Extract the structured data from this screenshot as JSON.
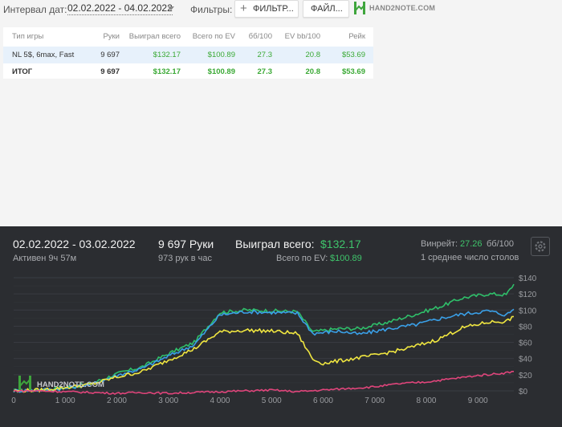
{
  "toolbar": {
    "date_label": "Интервал дат:",
    "date_range": "02.02.2022 - 04.02.2022",
    "filters_label": "Фильтры:",
    "filter_button": "ФИЛЬТР...",
    "files_button": "ФАЙЛ...",
    "logo_text": "HAND2NOTE.COM"
  },
  "table": {
    "headers": [
      "Тип игры",
      "Руки",
      "Выиграл всего",
      "Всего по EV",
      "бб/100",
      "EV bb/100",
      "Рейк"
    ],
    "rows": [
      [
        "NL 5$, 6max, Fast",
        "9 697",
        "$132.17",
        "$100.89",
        "27.3",
        "20.8",
        "$53.69"
      ],
      [
        "ИТОГ",
        "9 697",
        "$132.17",
        "$100.89",
        "27.3",
        "20.8",
        "$53.69"
      ]
    ]
  },
  "panel": {
    "date_range": "02.02.2022 - 03.02.2022",
    "active": "Активен 9ч 57м",
    "hands": "9 697 Руки",
    "hands_per_hour": "973 рук в час",
    "won_label": "Выиграл всего:",
    "won_value": "$132.17",
    "ev_label": "Всего по EV:",
    "ev_value": "$100.89",
    "winrate_label": "Винрейт:",
    "winrate_value": "27.26",
    "winrate_unit": "бб/100",
    "tables": "1 среднее число столов",
    "logo_text": "HAND2NOTE.COM",
    "gear_icon": "gear-icon"
  },
  "colors": {
    "won": "#2fbf6a",
    "ev": "#3aa0e8",
    "showdown": "#f0e640",
    "non_showdown": "#e0457b",
    "positive": "#3aa935"
  },
  "chart_data": {
    "type": "line",
    "x_ticks": [
      "0",
      "1 000",
      "2 000",
      "3 000",
      "4 000",
      "5 000",
      "6 000",
      "7 000",
      "8 000",
      "9 000"
    ],
    "y_ticks": [
      "$140",
      "$120",
      "$100",
      "$80",
      "$60",
      "$40",
      "$20",
      "$0"
    ],
    "xlim": [
      0,
      9697
    ],
    "ylim": [
      -5,
      145
    ],
    "series": [
      {
        "color": "#2fbf6a",
        "points": [
          [
            0,
            0
          ],
          [
            500,
            1
          ],
          [
            1000,
            4
          ],
          [
            1500,
            9
          ],
          [
            2000,
            21
          ],
          [
            2500,
            30
          ],
          [
            3000,
            46
          ],
          [
            3500,
            60
          ],
          [
            4000,
            97
          ],
          [
            4500,
            100
          ],
          [
            5000,
            99
          ],
          [
            5500,
            98
          ],
          [
            5800,
            73
          ],
          [
            6300,
            77
          ],
          [
            6700,
            77
          ],
          [
            7200,
            84
          ],
          [
            7800,
            95
          ],
          [
            8300,
            105
          ],
          [
            8700,
            115
          ],
          [
            9200,
            120
          ],
          [
            9550,
            119
          ],
          [
            9697,
            132
          ]
        ]
      },
      {
        "color": "#3aa0e8",
        "points": [
          [
            0,
            0
          ],
          [
            500,
            1
          ],
          [
            1000,
            3
          ],
          [
            1500,
            8
          ],
          [
            2000,
            19
          ],
          [
            2500,
            28
          ],
          [
            3000,
            43
          ],
          [
            3500,
            57
          ],
          [
            4000,
            94
          ],
          [
            4500,
            98
          ],
          [
            5000,
            97
          ],
          [
            5500,
            96
          ],
          [
            5800,
            71
          ],
          [
            6300,
            74
          ],
          [
            6700,
            70
          ],
          [
            7200,
            76
          ],
          [
            7800,
            82
          ],
          [
            8300,
            90
          ],
          [
            8700,
            95
          ],
          [
            9200,
            99
          ],
          [
            9550,
            94
          ],
          [
            9697,
            101
          ]
        ]
      },
      {
        "color": "#f0e640",
        "points": [
          [
            0,
            0
          ],
          [
            500,
            1
          ],
          [
            1000,
            4
          ],
          [
            1500,
            8
          ],
          [
            2000,
            17
          ],
          [
            2500,
            24
          ],
          [
            3000,
            38
          ],
          [
            3500,
            52
          ],
          [
            4000,
            73
          ],
          [
            4500,
            75
          ],
          [
            5000,
            74
          ],
          [
            5500,
            71
          ],
          [
            5800,
            39
          ],
          [
            6000,
            34
          ],
          [
            6500,
            39
          ],
          [
            7000,
            44
          ],
          [
            7600,
            52
          ],
          [
            8200,
            63
          ],
          [
            8700,
            78
          ],
          [
            9200,
            85
          ],
          [
            9550,
            86
          ],
          [
            9697,
            92
          ]
        ]
      },
      {
        "color": "#e0457b",
        "points": [
          [
            0,
            0
          ],
          [
            500,
            0
          ],
          [
            1000,
            -1
          ],
          [
            1500,
            -2
          ],
          [
            2000,
            -3
          ],
          [
            2500,
            -2
          ],
          [
            3000,
            -3
          ],
          [
            3500,
            -2
          ],
          [
            4000,
            -1
          ],
          [
            4500,
            0
          ],
          [
            5000,
            1
          ],
          [
            5500,
            -1
          ],
          [
            6000,
            1
          ],
          [
            6500,
            3
          ],
          [
            7000,
            5
          ],
          [
            7500,
            9
          ],
          [
            8000,
            11
          ],
          [
            8500,
            15
          ],
          [
            9000,
            19
          ],
          [
            9500,
            22
          ],
          [
            9697,
            24
          ]
        ]
      }
    ]
  }
}
